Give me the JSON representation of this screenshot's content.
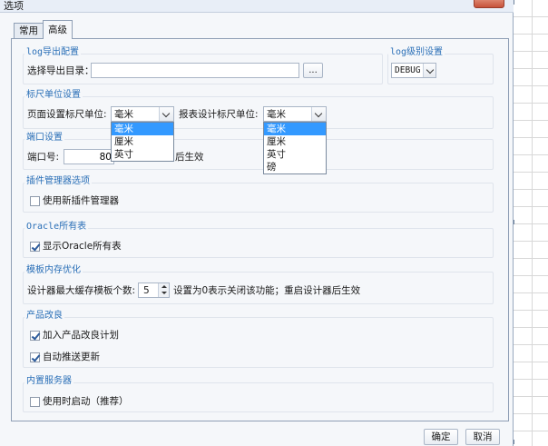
{
  "window": {
    "title": "选项"
  },
  "tabs": [
    {
      "label": "常用",
      "active": false
    },
    {
      "label": "高级",
      "active": true
    }
  ],
  "log_export": {
    "title": "log导出配置",
    "dir_label": "选择导出目录：",
    "dir_value": "",
    "browse_label": "..."
  },
  "log_level": {
    "title": "log级别设置",
    "value": "DEBUG"
  },
  "ruler": {
    "title": "标尺单位设置",
    "page_label": "页面设置标尺单位:",
    "page_value": "毫米",
    "page_options": [
      "毫米",
      "厘米",
      "英寸"
    ],
    "report_label": "报表设计标尺单位:",
    "report_value": "毫米",
    "report_options": [
      "毫米",
      "厘米",
      "英寸",
      "磅"
    ]
  },
  "port": {
    "title": "端口设置",
    "label": "端口号:",
    "value": "80",
    "suffix": "后生效"
  },
  "plugin": {
    "title": "插件管理器选项",
    "checkbox_label": "使用新插件管理器",
    "checked": false
  },
  "oracle": {
    "title": "Oracle所有表",
    "checkbox_label": "显示Oracle所有表",
    "checked": true
  },
  "template_mem": {
    "title": "模板内存优化",
    "label": "设计器最大缓存模板个数:",
    "value": "5",
    "hint": "设置为0表示关闭该功能；重启设计器后生效"
  },
  "improve": {
    "title": "产品改良",
    "join_label": "加入产品改良计划",
    "join_checked": true,
    "push_label": "自动推送更新",
    "push_checked": true
  },
  "server": {
    "title": "内置服务器",
    "checkbox_label": "使用时启动（推荐）",
    "checked": false
  },
  "footer": {
    "ok_label": "确定",
    "cancel_label": "取消"
  },
  "colors": {
    "section_title": "#2a6fb7",
    "selection": "#3399ff",
    "close_button": "#c7523a"
  }
}
